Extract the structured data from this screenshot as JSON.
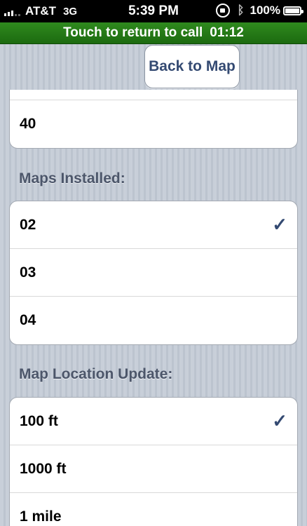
{
  "status_bar": {
    "carrier": "AT&T",
    "network": "3G",
    "time": "5:39 PM",
    "battery": "100%",
    "icons": [
      "signal-icon",
      "lock-rotation-icon",
      "bluetooth-icon",
      "battery-icon"
    ]
  },
  "call_bar": {
    "label": "Touch to return to call",
    "timer": "01:12"
  },
  "toolbar": {
    "back_label": "Back to Map"
  },
  "group_top": {
    "items": [
      {
        "label": "40"
      }
    ]
  },
  "maps_installed": {
    "header": "Maps Installed:",
    "items": [
      {
        "label": "02",
        "checked": true
      },
      {
        "label": "03",
        "checked": false
      },
      {
        "label": "04",
        "checked": false
      }
    ]
  },
  "map_location_update": {
    "header": "Map Location Update:",
    "items": [
      {
        "label": "100 ft",
        "checked": true
      },
      {
        "label": "1000 ft",
        "checked": false
      },
      {
        "label": "1 mile",
        "checked": false
      }
    ]
  },
  "check_glyph": "✓",
  "colors": {
    "accent": "#344a72",
    "call_bar": "#2f8a1e",
    "header_text": "#4c566a"
  }
}
